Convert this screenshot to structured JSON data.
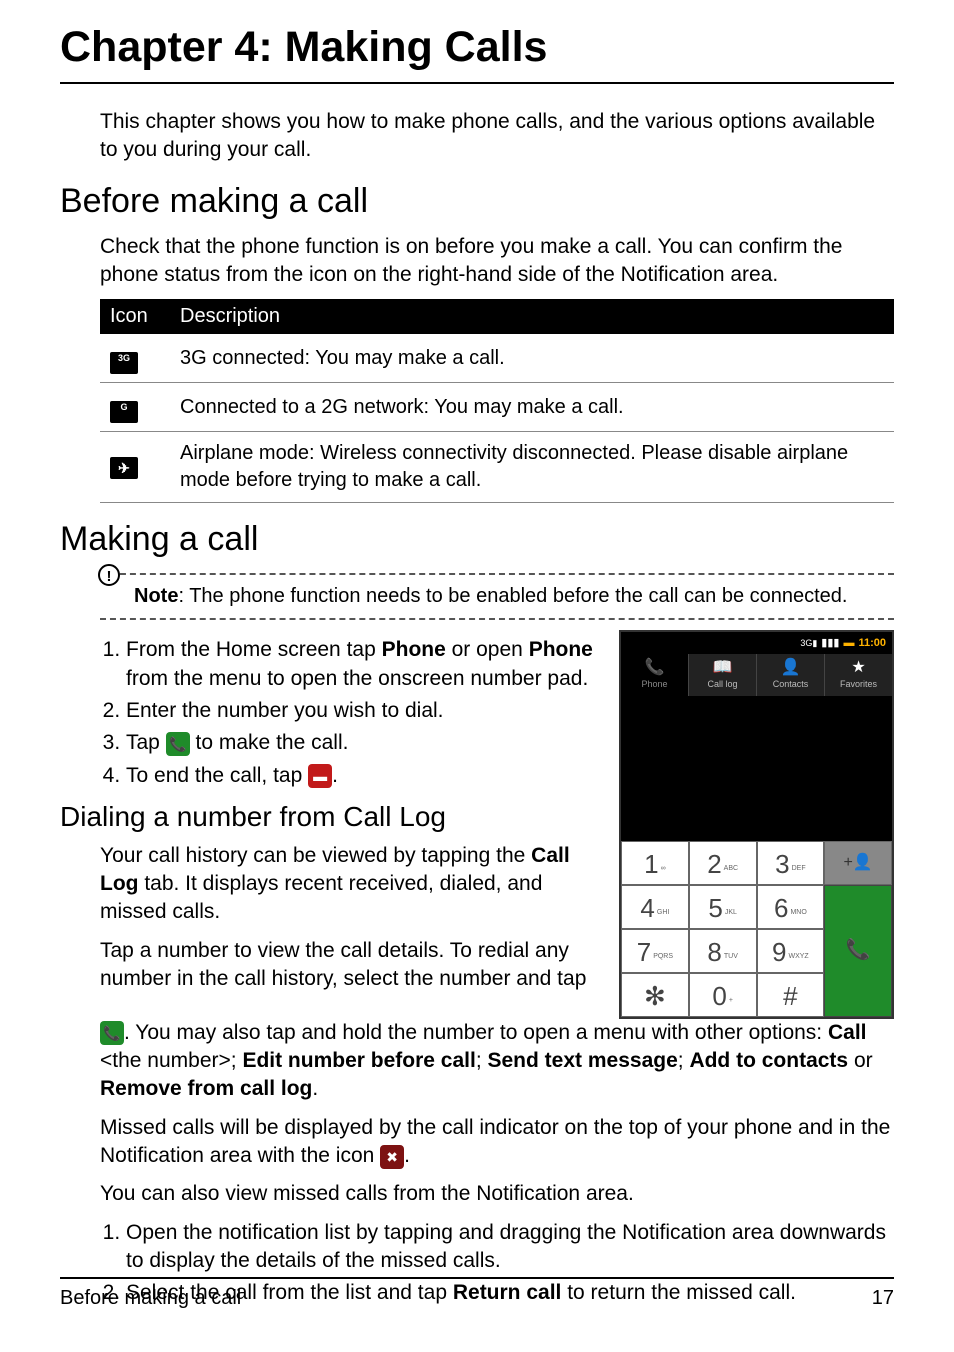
{
  "chapter": {
    "title": "Chapter 4: Making Calls"
  },
  "intro": "This chapter shows you how to make phone calls, and the various options available to you during your call.",
  "section_before": {
    "heading": "Before making a call",
    "body": "Check that the phone function is on before you make a call. You can confirm the phone status from the icon on the right-hand side of the Notification area.",
    "table": {
      "col_icon": "Icon",
      "col_desc": "Description",
      "rows": [
        {
          "icon": "3G",
          "desc": "3G connected: You may make a call."
        },
        {
          "icon": "G",
          "desc": "Connected to a 2G network: You may make a call."
        },
        {
          "icon": "✈",
          "desc": "Airplane mode: Wireless connectivity disconnected. Please disable airplane mode before trying to make a call."
        }
      ]
    }
  },
  "section_making": {
    "heading": "Making a call",
    "note_label": "Note",
    "note_body": ": The phone function needs to be enabled before the call can be connected.",
    "steps": {
      "s1a": "From the Home screen tap ",
      "s1b": "Phone",
      "s1c": " or open ",
      "s1d": "Phone",
      "s1e": " from the menu to open the onscreen number pad.",
      "s2": "Enter the number you wish to dial.",
      "s3a": "Tap ",
      "s3b": " to make the call.",
      "s4a": "To end the call, tap ",
      "s4b": "."
    }
  },
  "section_calllog": {
    "heading": "Dialing a number from Call Log",
    "p1a": "Your call history can be viewed by tapping the ",
    "p1b": "Call Log",
    "p1c": " tab. It displays recent received, dialed, and missed calls.",
    "p2": "Tap a number to view the call details. To redial any number in the call history, select the number and tap",
    "p3a": ". You may also tap and hold the number to open a menu with other options: ",
    "p3b": "Call",
    "p3c": " <the number>; ",
    "p3d": "Edit number before call",
    "p3e": "; ",
    "p3f": "Send text message",
    "p3g": "; ",
    "p3h": "Add to contacts",
    "p3i": " or ",
    "p3j": "Remove from call log",
    "p3k": ".",
    "p4a": "Missed calls will be displayed by the call indicator on the top of your phone and in the Notification area with the icon ",
    "p4b": ".",
    "p5": "You can also view missed calls from the Notification area.",
    "steps2": {
      "s1": "Open the notification list by tapping and dragging the Notification area downwards to display the details of the missed calls.",
      "s2a": "Select the call from the list and tap ",
      "s2b": "Return call",
      "s2c": " to return the missed call."
    }
  },
  "phone_mock": {
    "time": "11:00",
    "tabs": {
      "phone": "Phone",
      "calllog": "Call log",
      "contacts": "Contacts",
      "favorites": "Favorites"
    },
    "keys": {
      "k1": "1",
      "k1s": "∞",
      "k2": "2",
      "k2s": "ABC",
      "k3": "3",
      "k3s": "DEF",
      "k4": "4",
      "k4s": "GHI",
      "k5": "5",
      "k5s": "JKL",
      "k6": "6",
      "k6s": "MNO",
      "k7": "7",
      "k7s": "PQRS",
      "k8": "8",
      "k8s": "TUV",
      "k9": "9",
      "k9s": "WXYZ",
      "kstar": "✻",
      "k0": "0",
      "k0s": "+",
      "khash": "#"
    }
  },
  "footer": {
    "left": "Before making a call",
    "right": "17"
  }
}
